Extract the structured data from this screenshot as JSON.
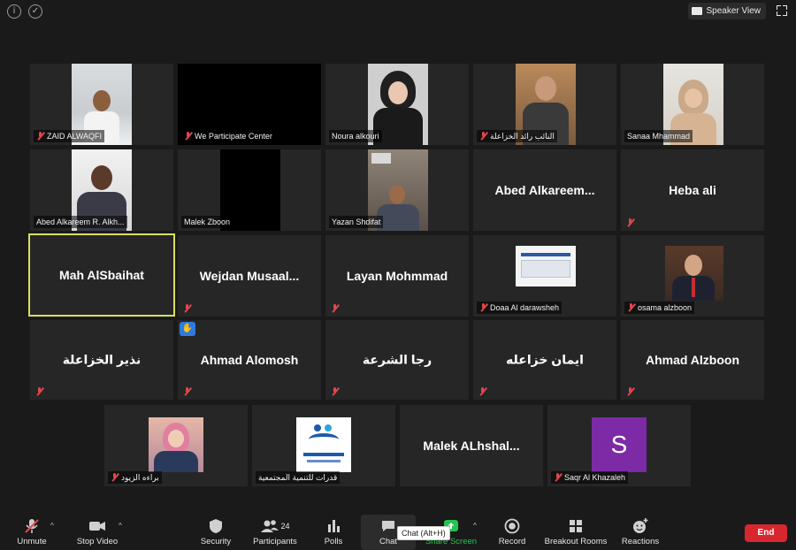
{
  "topbar": {
    "speaker_view_label": "Speaker View"
  },
  "tiles": [
    {
      "name": "ZAID ALWAQFI",
      "kind": "video"
    },
    {
      "name": "We Participate Center",
      "kind": "video-black"
    },
    {
      "name": "Noura alkouri",
      "kind": "video"
    },
    {
      "name": "النائب رائد الخزاعلة",
      "kind": "video"
    },
    {
      "name": "Sanaa Mhammad",
      "kind": "video"
    },
    {
      "name": "Abed Alkareem R. Alkh...",
      "kind": "video"
    },
    {
      "name": "Malek Zboon",
      "kind": "video-black"
    },
    {
      "name": "Yazan Shdifat",
      "kind": "video"
    },
    {
      "name": "Abed  Alkareem...",
      "kind": "name"
    },
    {
      "name": "Heba ali",
      "kind": "name"
    },
    {
      "name": "Mah AlSbaihat",
      "kind": "name-active"
    },
    {
      "name": "Wejdan  Musaal...",
      "kind": "name"
    },
    {
      "name": "Layan Mohmmad",
      "kind": "name"
    },
    {
      "name": "Doaa Al darawsheh",
      "kind": "video"
    },
    {
      "name": "osama alzboon",
      "kind": "video"
    },
    {
      "name": "نذير الخزاعلة",
      "kind": "name"
    },
    {
      "name": "Ahmad Alomosh",
      "kind": "name-hand"
    },
    {
      "name": "رجا الشرعة",
      "kind": "name"
    },
    {
      "name": "ايمان خزاعله",
      "kind": "name"
    },
    {
      "name": "Ahmad Alzboon",
      "kind": "name"
    },
    {
      "name": "براءه الزيود",
      "kind": "video"
    },
    {
      "name": "قدرات للتنمية المجتمعية",
      "kind": "video"
    },
    {
      "name": "Malek  ALhshal...",
      "kind": "name"
    },
    {
      "name": "Saqr Al Khazaleh",
      "kind": "avatar",
      "avatar_letter": "S",
      "avatar_color": "#7d2aa6"
    }
  ],
  "toolbar": {
    "unmute": "Unmute",
    "stop_video": "Stop Video",
    "security": "Security",
    "participants": "Participants",
    "participants_count": "24",
    "polls": "Polls",
    "chat": "Chat",
    "share_screen": "Share Screen",
    "record": "Record",
    "breakout_rooms": "Breakout Rooms",
    "reactions": "Reactions",
    "end": "End",
    "chat_tooltip": "Chat (Alt+H)"
  },
  "colors": {
    "accent_active_border": "#d8e05a",
    "end_button": "#d7262e",
    "share_green": "#23c552",
    "muted_mic": "#e0474c"
  }
}
